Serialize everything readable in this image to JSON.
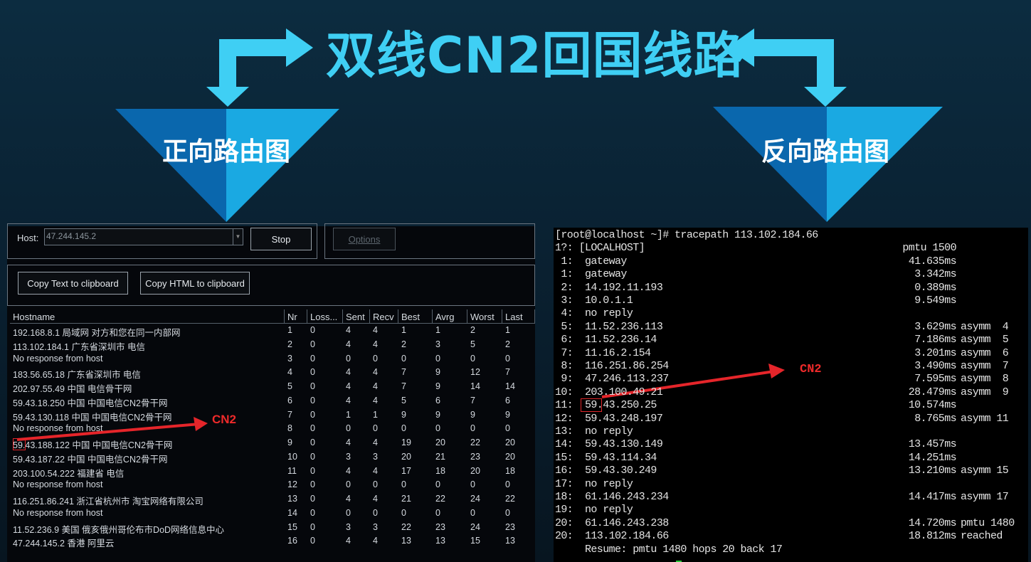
{
  "title": "双线CN2回国线路",
  "forward_label": "正向路由图",
  "reverse_label": "反向路由图",
  "colors": {
    "accent": "#3fcff4",
    "triangle_dark": "#0a67ad",
    "triangle_light": "#1aa9e2",
    "annotation": "#ee2a2a"
  },
  "mtr": {
    "host_label": "Host:",
    "host_value": "47.244.145.2",
    "stop_label": "Stop",
    "options_label": "Options",
    "copy_text_label": "Copy Text to clipboard",
    "copy_html_label": "Copy HTML to clipboard",
    "columns": [
      "Hostname",
      "Nr",
      "Loss...",
      "Sent",
      "Recv",
      "Best",
      "Avrg",
      "Worst",
      "Last"
    ],
    "rows": [
      [
        "192.168.8.1 局域网 对方和您在同一内部网",
        "1",
        "0",
        "4",
        "4",
        "1",
        "1",
        "2",
        "1"
      ],
      [
        "113.102.184.1 广东省深圳市 电信",
        "2",
        "0",
        "4",
        "4",
        "2",
        "3",
        "5",
        "2"
      ],
      [
        "No response from host",
        "3",
        "0",
        "0",
        "0",
        "0",
        "0",
        "0",
        "0"
      ],
      [
        "183.56.65.18 广东省深圳市 电信",
        "4",
        "0",
        "4",
        "4",
        "7",
        "9",
        "12",
        "7"
      ],
      [
        "202.97.55.49 中国 电信骨干网",
        "5",
        "0",
        "4",
        "4",
        "7",
        "9",
        "14",
        "14"
      ],
      [
        "59.43.18.250 中国 中国电信CN2骨干网",
        "6",
        "0",
        "4",
        "4",
        "5",
        "6",
        "7",
        "6"
      ],
      [
        "59.43.130.118 中国 中国电信CN2骨干网",
        "7",
        "0",
        "1",
        "1",
        "9",
        "9",
        "9",
        "9"
      ],
      [
        "No response from host",
        "8",
        "0",
        "0",
        "0",
        "0",
        "0",
        "0",
        "0"
      ],
      [
        "59.43.188.122 中国 中国电信CN2骨干网",
        "9",
        "0",
        "4",
        "4",
        "19",
        "20",
        "22",
        "20"
      ],
      [
        "59.43.187.22 中国 中国电信CN2骨干网",
        "10",
        "0",
        "3",
        "3",
        "20",
        "21",
        "23",
        "20"
      ],
      [
        "203.100.54.222 福建省 电信",
        "11",
        "0",
        "4",
        "4",
        "17",
        "18",
        "20",
        "18"
      ],
      [
        "No response from host",
        "12",
        "0",
        "0",
        "0",
        "0",
        "0",
        "0",
        "0"
      ],
      [
        "116.251.86.241 浙江省杭州市 淘宝网络有限公司",
        "13",
        "0",
        "4",
        "4",
        "21",
        "22",
        "24",
        "22"
      ],
      [
        "No response from host",
        "14",
        "0",
        "0",
        "0",
        "0",
        "0",
        "0",
        "0"
      ],
      [
        "11.52.236.9 美国 俄亥俄州哥伦布市DoD网络信息中心",
        "15",
        "0",
        "3",
        "3",
        "22",
        "23",
        "24",
        "23"
      ],
      [
        "47.244.145.2 香港 阿里云",
        "16",
        "0",
        "4",
        "4",
        "13",
        "13",
        "15",
        "13"
      ]
    ],
    "annotation": "CN2"
  },
  "terminal": {
    "prompt": "[root@localhost ~]# tracepath 113.102.184.66",
    "lines": [
      [
        "1?: [LOCALHOST]",
        "pmtu 1500",
        ""
      ],
      [
        " 1:  gateway",
        "41.635ms",
        ""
      ],
      [
        " 1:  gateway",
        "3.342ms",
        ""
      ],
      [
        " 2:  14.192.11.193",
        "0.389ms",
        ""
      ],
      [
        " 3:  10.0.1.1",
        "9.549ms",
        ""
      ],
      [
        " 4:  no reply",
        "",
        ""
      ],
      [
        " 5:  11.52.236.113",
        "3.629ms",
        "asymm  4"
      ],
      [
        " 6:  11.52.236.14",
        "7.186ms",
        "asymm  5"
      ],
      [
        " 7:  11.16.2.154",
        "3.201ms",
        "asymm  6"
      ],
      [
        " 8:  116.251.86.254",
        "3.490ms",
        "asymm  7"
      ],
      [
        " 9:  47.246.113.237",
        "7.595ms",
        "asymm  8"
      ],
      [
        "10:  203.100.49.21",
        "28.479ms",
        "asymm  9"
      ],
      [
        "11:  59.43.250.25",
        "10.574ms",
        ""
      ],
      [
        "12:  59.43.248.197",
        "8.765ms",
        "asymm 11"
      ],
      [
        "13:  no reply",
        "",
        ""
      ],
      [
        "14:  59.43.130.149",
        "13.457ms",
        ""
      ],
      [
        "15:  59.43.114.34",
        "14.251ms",
        ""
      ],
      [
        "16:  59.43.30.249",
        "13.210ms",
        "asymm 15"
      ],
      [
        "17:  no reply",
        "",
        ""
      ],
      [
        "18:  61.146.243.234",
        "14.417ms",
        "asymm 17"
      ],
      [
        "19:  no reply",
        "",
        ""
      ],
      [
        "20:  61.146.243.238",
        "14.720ms",
        "pmtu 1480"
      ],
      [
        "20:  113.102.184.66",
        "18.812ms",
        "reached"
      ]
    ],
    "resume": "     Resume: pmtu 1480 hops 20 back 17",
    "annotation": "CN2"
  }
}
